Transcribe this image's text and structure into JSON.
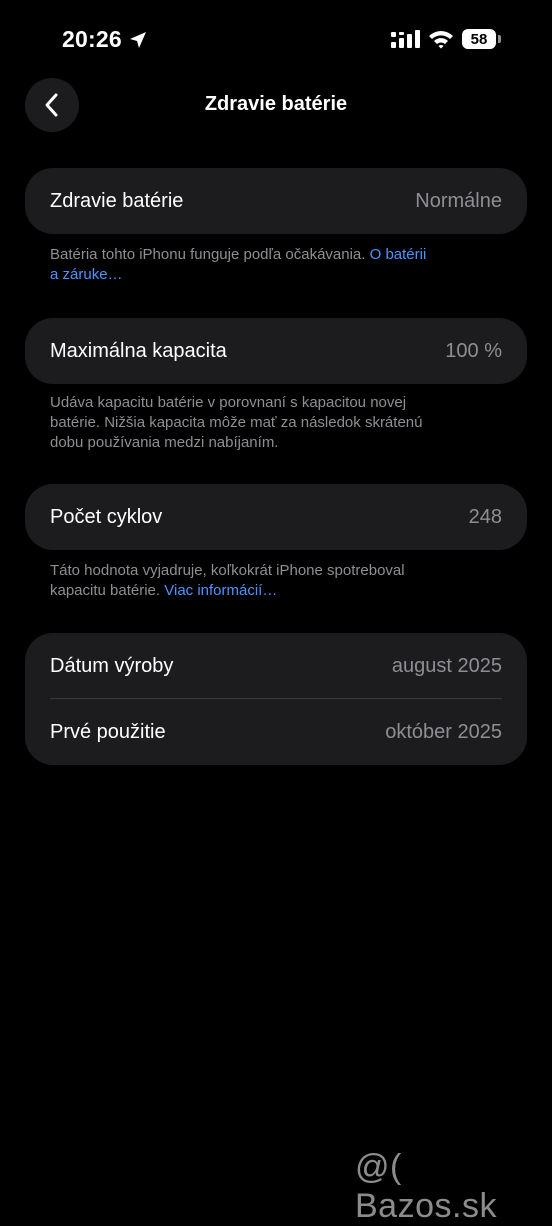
{
  "status_bar": {
    "time": "20:26",
    "battery_level": "58",
    "icons": [
      "location-arrow-icon",
      "cellular-signal-icon",
      "wifi-icon",
      "battery-icon"
    ]
  },
  "nav": {
    "back_icon": "chevron-left-icon",
    "title": "Zdravie batérie"
  },
  "battery_health": {
    "label": "Zdravie batérie",
    "value": "Normálne",
    "footnote_text": "Batéria tohto iPhonu funguje podľa očakávania. ",
    "footnote_link_1": "O batérii",
    "footnote_link_2": "a záruke…"
  },
  "max_capacity": {
    "label": "Maximálna kapacita",
    "value": "100 %",
    "footnote_line_1": "Udáva kapacitu batérie v porovnaní s kapacitou novej",
    "footnote_line_2": "batérie. Nižšia kapacita môže mať za následok skrátenú",
    "footnote_line_3": "dobu používania medzi nabíjaním."
  },
  "cycle_count": {
    "label": "Počet cyklov",
    "value": "248",
    "footnote_line_1": "Táto hodnota vyjadruje, koľkokrát iPhone spotreboval",
    "footnote_line_2": "kapacitu batérie. ",
    "footnote_link": "Viac informácií…"
  },
  "dates": {
    "manufacture_label": "Dátum výroby",
    "manufacture_value": "august 2025",
    "first_use_label": "Prvé použitie",
    "first_use_value": "október 2025"
  },
  "watermark": "@( Bazos.sk",
  "colors": {
    "background": "#000000",
    "card": "#1c1c1e",
    "secondary_text": "#8e8e93",
    "link": "#4c93ff"
  }
}
